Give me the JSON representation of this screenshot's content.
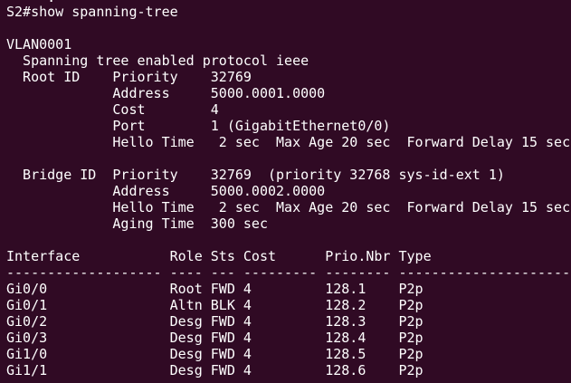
{
  "terminal": {
    "background": "#300a24",
    "foreground": "#ffffff",
    "partial_top_line": "     .                                   ",
    "lines": [
      "S2#show spanning-tree",
      "",
      "VLAN0001",
      "  Spanning tree enabled protocol ieee",
      "  Root ID    Priority    32769",
      "             Address     5000.0001.0000",
      "             Cost        4",
      "             Port        1 (GigabitEthernet0/0)",
      "             Hello Time   2 sec  Max Age 20 sec  Forward Delay 15 sec",
      "",
      "  Bridge ID  Priority    32769  (priority 32768 sys-id-ext 1)",
      "             Address     5000.0002.0000",
      "             Hello Time   2 sec  Max Age 20 sec  Forward Delay 15 sec",
      "             Aging Time  300 sec",
      "",
      "Interface           Role Sts Cost      Prio.Nbr Type",
      "------------------- ---- --- --------- -------- --------------------------------",
      "Gi0/0               Root FWD 4         128.1    P2p",
      "Gi0/1               Altn BLK 4         128.2    P2p",
      "Gi0/2               Desg FWD 4         128.3    P2p",
      "Gi0/3               Desg FWD 4         128.4    P2p",
      "Gi1/0               Desg FWD 4         128.5    P2p",
      "Gi1/1               Desg FWD 4         128.6    P2p"
    ]
  }
}
